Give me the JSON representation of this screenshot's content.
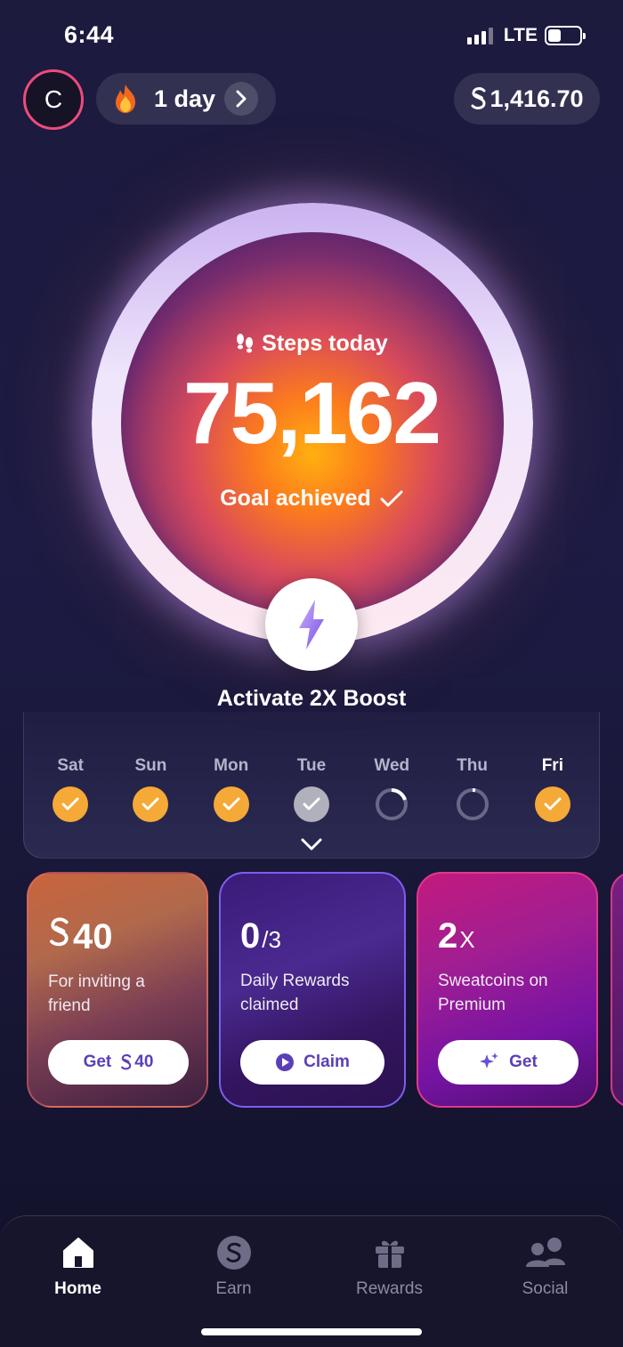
{
  "status": {
    "time": "6:44",
    "network": "LTE"
  },
  "header": {
    "avatar_initial": "C",
    "streak_label": "1 day",
    "balance": "1,416.70"
  },
  "steps": {
    "label": "Steps today",
    "value": "75,162",
    "goal_text": "Goal achieved"
  },
  "boost": {
    "label": "Activate 2X Boost"
  },
  "week": {
    "days": [
      {
        "name": "Sat",
        "state": "done"
      },
      {
        "name": "Sun",
        "state": "done"
      },
      {
        "name": "Mon",
        "state": "done"
      },
      {
        "name": "Tue",
        "state": "partial"
      },
      {
        "name": "Wed",
        "state": "in-progress"
      },
      {
        "name": "Thu",
        "state": "in-progress"
      },
      {
        "name": "Fri",
        "state": "done"
      }
    ]
  },
  "cards": [
    {
      "big": "40",
      "text": "For inviting a friend",
      "button": "Get",
      "button_amount": "40"
    },
    {
      "big": "0",
      "big_suffix": "/3",
      "text": "Daily Rewards claimed",
      "button": "Claim"
    },
    {
      "big": "2",
      "big_suffix": "X",
      "text": "Sweatcoins on Premium",
      "button": "Get"
    }
  ],
  "tabs": [
    {
      "label": "Home",
      "icon": "home-icon",
      "active": true
    },
    {
      "label": "Earn",
      "icon": "sweatcoin-icon",
      "active": false
    },
    {
      "label": "Rewards",
      "icon": "gift-icon",
      "active": false
    },
    {
      "label": "Social",
      "icon": "people-icon",
      "active": false
    }
  ],
  "colors": {
    "accent": "#5b3fb8",
    "check": "#f5a937",
    "avatar_ring": "#ee4b7c"
  }
}
